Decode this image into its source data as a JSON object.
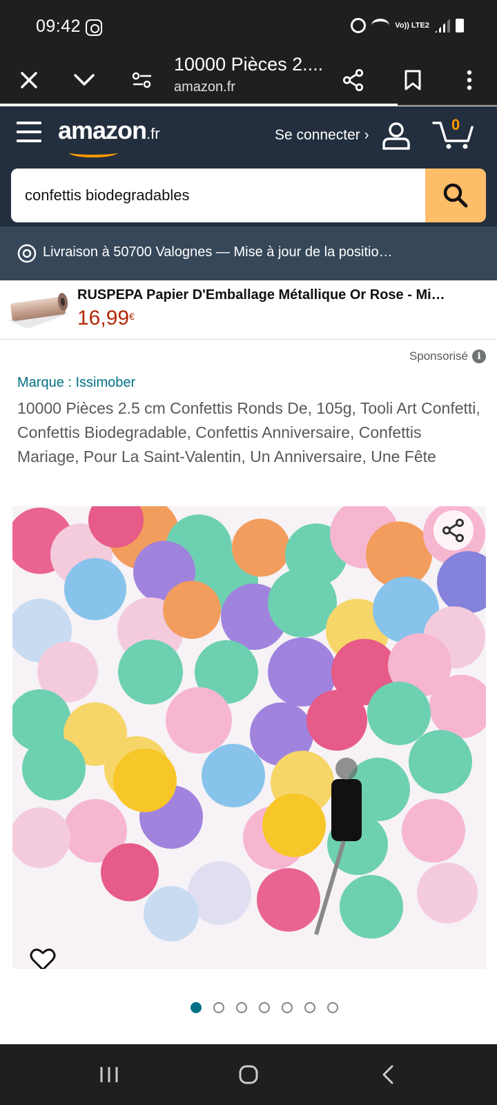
{
  "status_bar": {
    "time": "09:42",
    "network_label": "Vo)) LTE2",
    "icons": [
      "instagram-icon",
      "alarm-icon",
      "wifi-icon",
      "signal-icon",
      "battery-icon"
    ]
  },
  "browser": {
    "page_title": "10000 Pièces 2....",
    "url": "amazon.fr",
    "icons": [
      "close-icon",
      "chevron-down-icon",
      "page-settings-icon",
      "share-icon",
      "bookmark-icon",
      "more-vert-icon"
    ],
    "load_progress": 0.8
  },
  "header": {
    "logo_text": "amazon",
    "logo_tld": ".fr",
    "signin_label": "Se connecter ›",
    "cart_count": "0",
    "search_value": "confettis biodegradables",
    "colors": {
      "header_bg": "#232f3e",
      "search_button": "#febd69",
      "accent": "#ff9900"
    }
  },
  "delivery": {
    "text": "Livraison à 50700 Valognes — Mise à jour de la positio…"
  },
  "sponsored_banner": {
    "title": "RUSPEPA Papier D'Emballage Métallique Or Rose - Mi…",
    "price": "16,99",
    "currency": "€"
  },
  "product": {
    "sponsored_label": "Sponsorisé",
    "brand": "Marque : Issimober",
    "title": "10000 Pièces 2.5 cm Confettis Ronds De, 105g, Tooli Art Confetti, Confettis Biodegradable, Confettis Anniversaire, Confettis Mariage, Pour La Saint-Valentin, Un Anniversaire, Une Fête",
    "image_count": 7,
    "active_image": 1
  }
}
